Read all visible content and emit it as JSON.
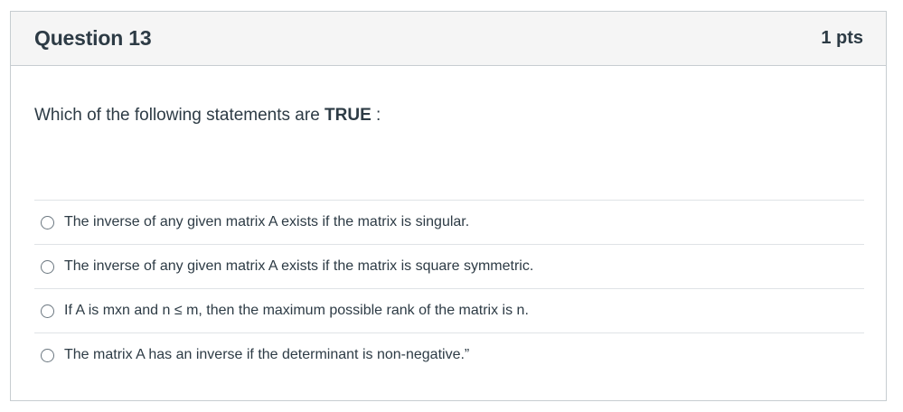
{
  "question": {
    "title": "Question 13",
    "points": "1 pts",
    "prompt_prefix": "Which of the following statements are ",
    "prompt_bold": "TRUE",
    "prompt_suffix": " :"
  },
  "answers": [
    {
      "label": "The inverse of any given matrix A exists if the matrix is singular."
    },
    {
      "label": "The inverse of any given matrix A exists if the matrix is square symmetric."
    },
    {
      "label": "If A is mxn and n ≤ m, then the maximum possible rank of the matrix is n."
    },
    {
      "label": "The matrix A has an inverse if the determinant is non-negative.”"
    }
  ]
}
